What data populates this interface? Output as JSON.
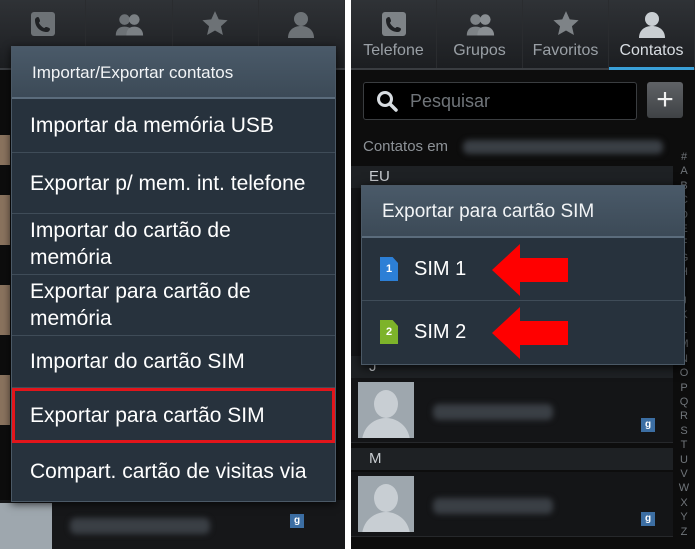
{
  "left": {
    "menu": {
      "title": "Importar/Exportar contatos",
      "items": [
        {
          "label": "Importar da memória USB"
        },
        {
          "label": "Exportar p/ mem. int. telefone"
        },
        {
          "label": "Importar do cartão de memória"
        },
        {
          "label": "Exportar para cartão de memória"
        },
        {
          "label": "Importar do cartão SIM"
        },
        {
          "label": "Exportar para cartão SIM"
        },
        {
          "label": "Compart. cartão de visitas via"
        }
      ]
    },
    "badge": "g"
  },
  "right": {
    "tabs": [
      {
        "label": "Telefone",
        "icon": "phone-icon"
      },
      {
        "label": "Grupos",
        "icon": "groups-icon"
      },
      {
        "label": "Favoritos",
        "icon": "star-icon"
      },
      {
        "label": "Contatos",
        "icon": "contact-icon"
      }
    ],
    "search": {
      "placeholder": "Pesquisar"
    },
    "add_label": "+",
    "contacts_in": "Contatos em",
    "sections": {
      "eu": "EU",
      "j": "J",
      "m": "M"
    },
    "alphabet": [
      "#",
      "A",
      "B",
      "C",
      "D",
      "E",
      "F",
      "G",
      "H",
      "I",
      "J",
      "K",
      "L",
      "M",
      "N",
      "O",
      "P",
      "Q",
      "R",
      "S",
      "T",
      "U",
      "V",
      "W",
      "X",
      "Y",
      "Z"
    ],
    "badge": "g",
    "dialog": {
      "title": "Exportar para cartão SIM",
      "options": [
        {
          "label": "SIM 1",
          "badge": "1",
          "color": "#2c7fd6"
        },
        {
          "label": "SIM 2",
          "badge": "2",
          "color": "#7db32a"
        }
      ]
    }
  },
  "colors": {
    "accent": "#3aa0d8",
    "highlight": "#e2151b",
    "arrow": "#ff0000"
  }
}
